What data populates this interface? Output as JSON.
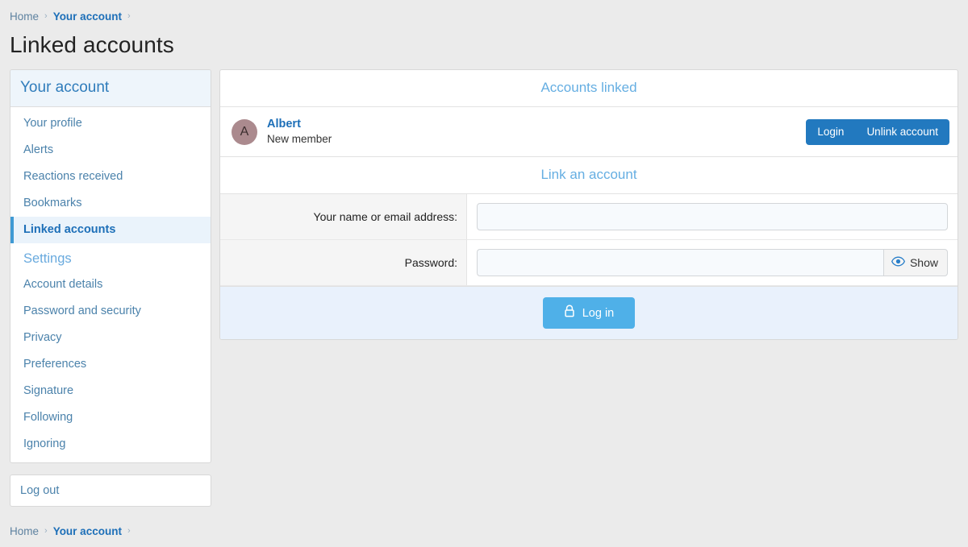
{
  "breadcrumb_top": {
    "home": "Home",
    "separator": "›",
    "current": "Your account",
    "trailing_separator": "›"
  },
  "page": {
    "title": "Linked accounts"
  },
  "sidebar": {
    "header": "Your account",
    "items": [
      {
        "label": "Your profile",
        "type": "link",
        "active": false
      },
      {
        "label": "Alerts",
        "type": "link",
        "active": false
      },
      {
        "label": "Reactions received",
        "type": "link",
        "active": false
      },
      {
        "label": "Bookmarks",
        "type": "link",
        "active": false
      },
      {
        "label": "Linked accounts",
        "type": "link",
        "active": true
      },
      {
        "label": "Settings",
        "type": "section-header",
        "active": false
      },
      {
        "label": "Account details",
        "type": "link",
        "active": false
      },
      {
        "label": "Password and security",
        "type": "link",
        "active": false
      },
      {
        "label": "Privacy",
        "type": "link",
        "active": false
      },
      {
        "label": "Preferences",
        "type": "link",
        "active": false
      },
      {
        "label": "Signature",
        "type": "link",
        "active": false
      },
      {
        "label": "Following",
        "type": "link",
        "active": false
      },
      {
        "label": "Ignoring",
        "type": "link",
        "active": false
      }
    ],
    "logout": "Log out"
  },
  "main": {
    "accounts_linked_title": "Accounts linked",
    "account": {
      "avatar_initial": "A",
      "name": "Albert",
      "user_title": "New member",
      "login_label": "Login",
      "unlink_label": "Unlink account"
    },
    "link_account_title": "Link an account",
    "form": {
      "name_label": "Your name or email address:",
      "name_value": "",
      "name_placeholder": "",
      "password_label": "Password:",
      "password_value": "",
      "password_placeholder": "",
      "show_label": "Show",
      "submit_label": "Log in"
    }
  },
  "breadcrumb_bottom": {
    "home": "Home",
    "separator": "›",
    "current": "Your account",
    "trailing_separator": "›"
  },
  "colors": {
    "page_bg": "#ebebeb",
    "accent_blue": "#1d6fb8",
    "panel_title_blue": "#65aee2",
    "button_dark_blue": "#2279bf",
    "button_light_blue": "#4fb0e8",
    "footer_bg": "#e9f1fc",
    "active_item_bg": "#eaf3fb",
    "active_item_border": "#3f9ad4",
    "avatar_bg": "#ab8a8e"
  }
}
